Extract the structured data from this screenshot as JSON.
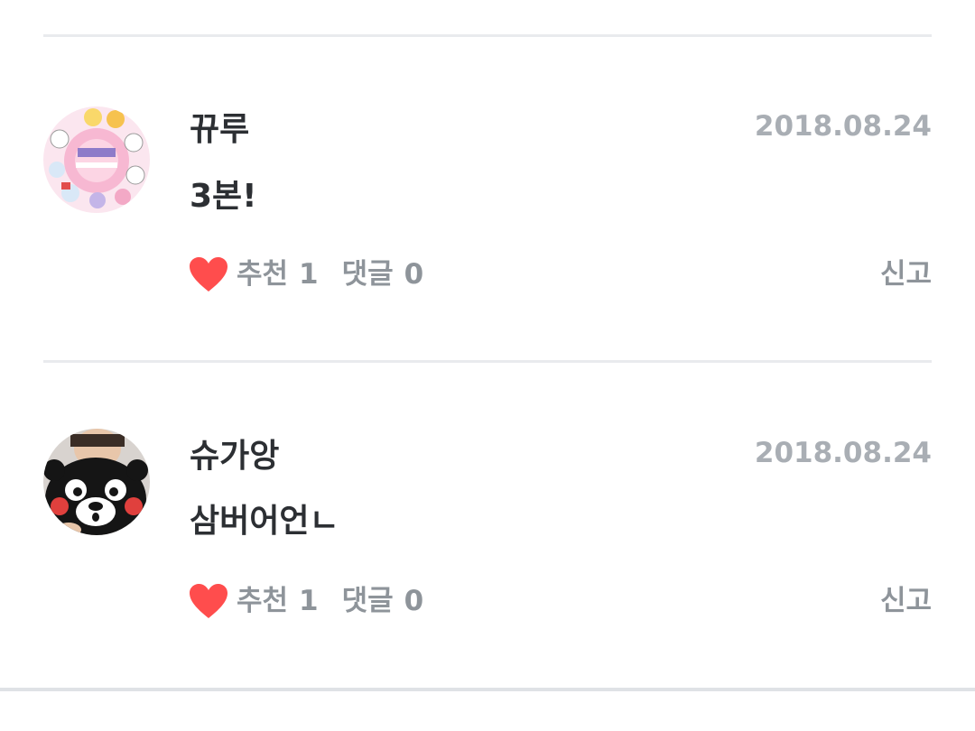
{
  "comments": [
    {
      "username": "뀨루",
      "date": "2018.08.24",
      "text": "3본!",
      "like_label": "추천",
      "like_count": "1",
      "reply_label": "댓글",
      "reply_count": "0",
      "report_label": "신고",
      "avatar_icon": "avatar-bt21-stickers"
    },
    {
      "username": "슈가앙",
      "date": "2018.08.24",
      "text": "삼버어언ㄴ",
      "like_label": "추천",
      "like_count": "1",
      "reply_label": "댓글",
      "reply_count": "0",
      "report_label": "신고",
      "avatar_icon": "avatar-kumamon-bear"
    }
  ],
  "colors": {
    "heart": "#ff4d4d",
    "text_primary": "#2c2f33",
    "text_secondary": "#8e949a",
    "date": "#a9aeb4",
    "divider": "#e9ebee"
  }
}
